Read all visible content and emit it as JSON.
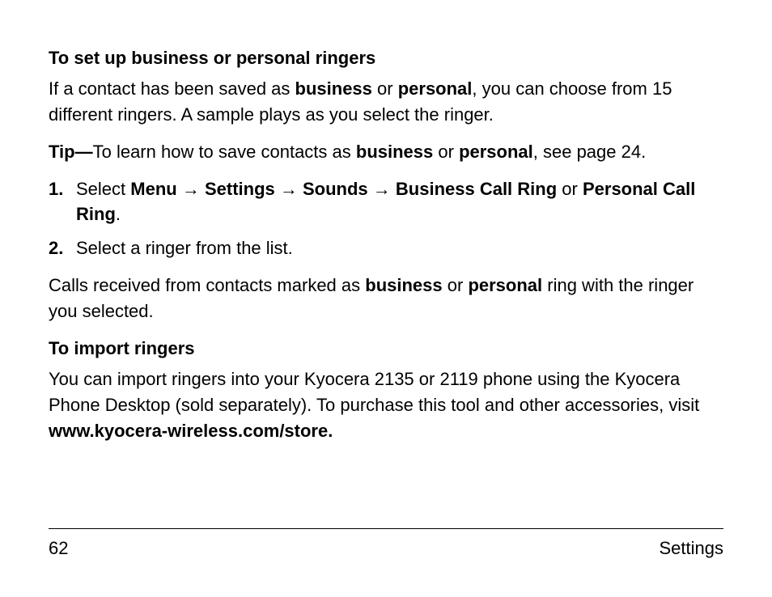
{
  "section1": {
    "heading": "To set up business or personal ringers",
    "intro_pre": "If a contact has been saved as ",
    "intro_b1": "business",
    "intro_mid1": " or ",
    "intro_b2": "personal",
    "intro_post": ", you can choose from 15 different ringers. A sample plays as you select the ringer.",
    "tip_label": "Tip—",
    "tip_pre": "To learn how to save contacts as ",
    "tip_b1": "business",
    "tip_mid": " or ",
    "tip_b2": "personal",
    "tip_post": ", see page 24.",
    "step1_num": "1.",
    "step1_pre": "Select ",
    "step1_menu": "Menu",
    "step1_arrow": " → ",
    "step1_settings": "Settings",
    "step1_sounds": "Sounds",
    "step1_bcr": "Business Call Ring",
    "step1_or": " or ",
    "step1_pcr": "Personal Call Ring",
    "step1_end": ".",
    "step2_num": "2.",
    "step2_text": "Select a ringer from the list.",
    "outro_pre": "Calls received from contacts marked as ",
    "outro_b1": "business",
    "outro_mid": " or ",
    "outro_b2": "personal",
    "outro_post": " ring with the ringer you selected."
  },
  "section2": {
    "heading": "To import ringers",
    "body_pre": "You can import ringers into your Kyocera 2135 or 2119 phone using the Kyocera Phone Desktop (sold separately). To purchase this tool and other accessories, visit ",
    "body_url": "www.kyocera-wireless.com/store."
  },
  "footer": {
    "page": "62",
    "label": "Settings"
  }
}
